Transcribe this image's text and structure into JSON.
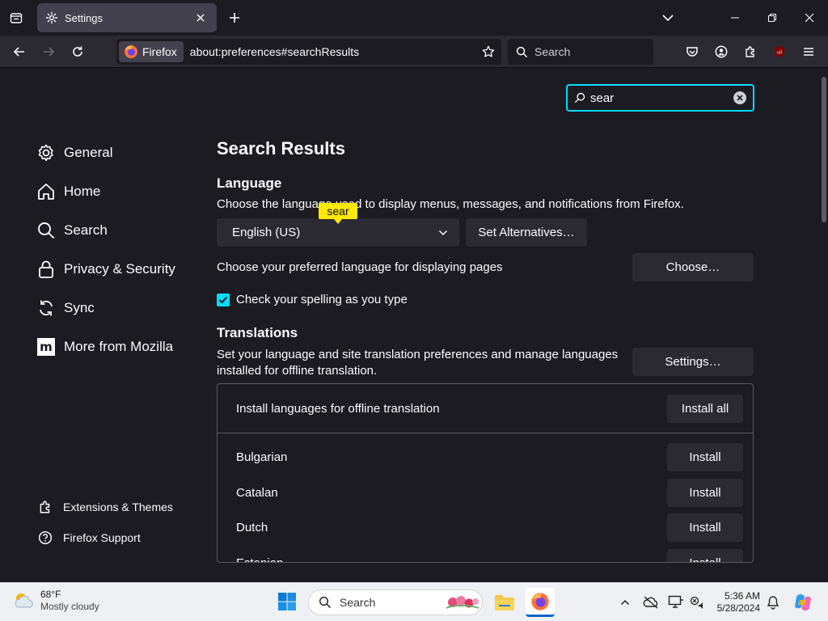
{
  "tab": {
    "title": "Settings"
  },
  "navbar": {
    "identity_label": "Firefox",
    "url": "about:preferences#searchResults",
    "search_placeholder": "Search"
  },
  "pref_search": {
    "value": "sear"
  },
  "sidebar": {
    "items": [
      {
        "label": "General",
        "icon": "gear-icon"
      },
      {
        "label": "Home",
        "icon": "home-icon"
      },
      {
        "label": "Search",
        "icon": "search-icon"
      },
      {
        "label": "Privacy & Security",
        "icon": "lock-icon"
      },
      {
        "label": "Sync",
        "icon": "sync-icon"
      },
      {
        "label": "More from Mozilla",
        "icon": "mozilla-icon"
      }
    ],
    "footer": [
      {
        "label": "Extensions & Themes",
        "icon": "puzzle-icon"
      },
      {
        "label": "Firefox Support",
        "icon": "help-icon"
      }
    ]
  },
  "main": {
    "title": "Search Results",
    "language": {
      "heading": "Language",
      "desc": "Choose the language used to display menus, messages, and notifications from Firefox.",
      "selected": "English (US)",
      "alternatives_button": "Set Alternatives…",
      "highlight": "sear",
      "pages_desc": "Choose your preferred language for displaying pages",
      "choose_button": "Choose…",
      "spellcheck_label": "Check your spelling as you type",
      "spellcheck_checked": true
    },
    "translations": {
      "heading": "Translations",
      "desc": "Set your language and site translation preferences and manage languages installed for offline translation.",
      "settings_button": "Settings…",
      "install_header": "Install languages for offline translation",
      "install_all_button": "Install all",
      "install_button": "Install",
      "languages": [
        "Bulgarian",
        "Catalan",
        "Dutch",
        "Estonian"
      ]
    }
  },
  "taskbar": {
    "weather_temp": "68°F",
    "weather_cond": "Mostly cloudy",
    "search_placeholder": "Search",
    "time": "5:36 AM",
    "date": "5/28/2024"
  },
  "colors": {
    "accent": "#00ddff",
    "highlight": "#ffe900",
    "background": "#1c1b22",
    "button": "#2b2a33"
  }
}
